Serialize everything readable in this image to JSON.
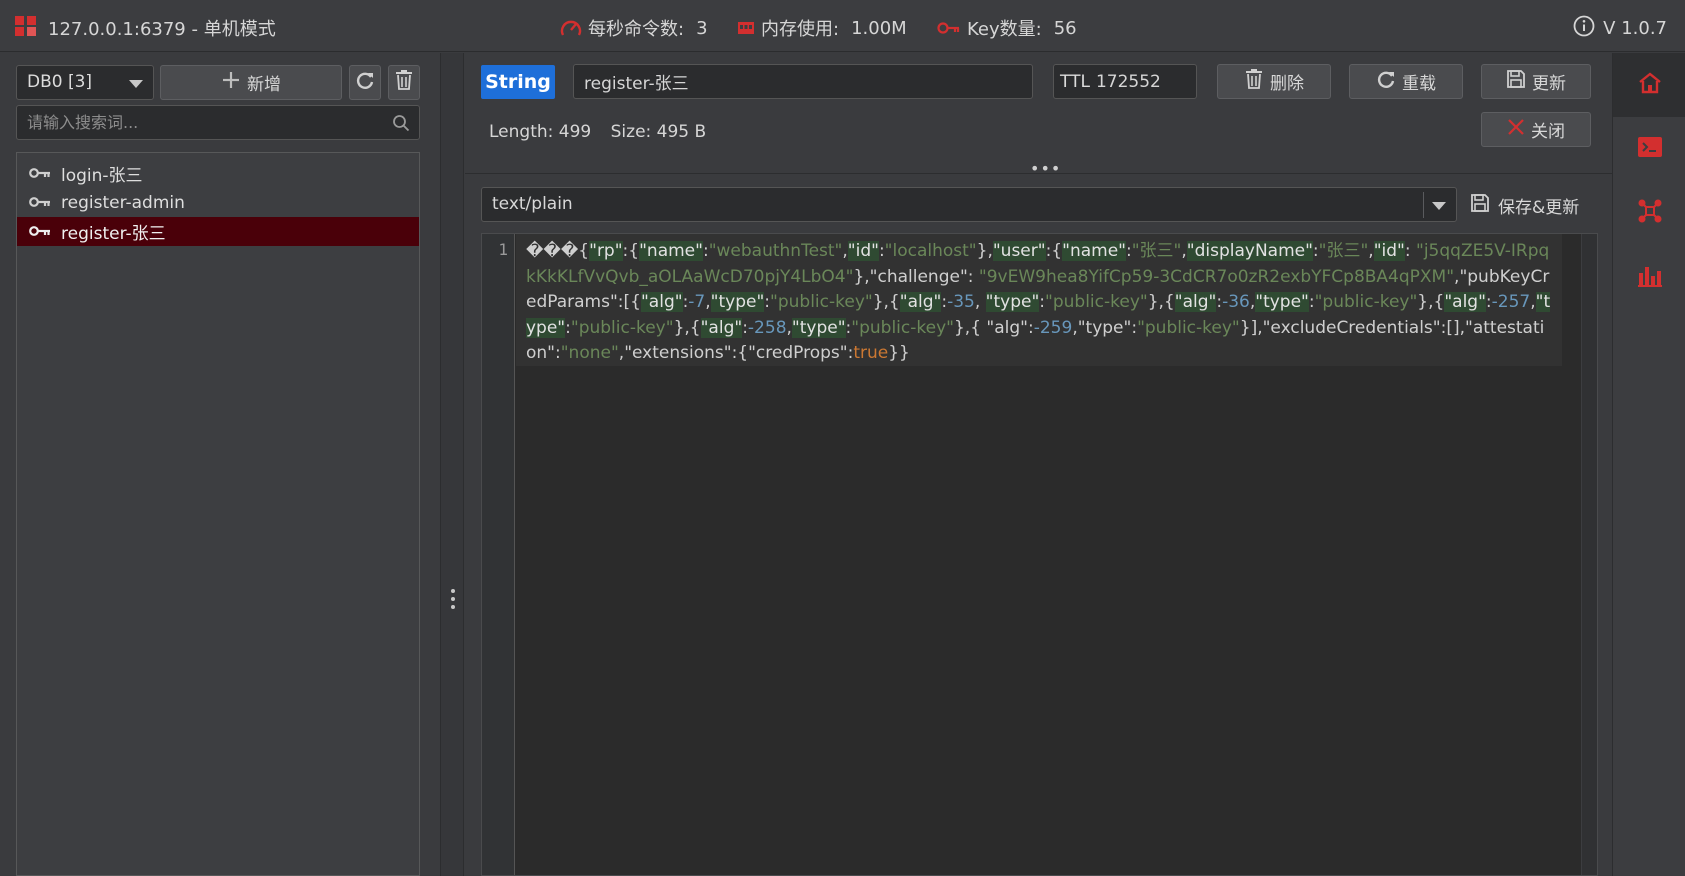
{
  "titlebar": {
    "connection": "127.0.0.1:6379 - 单机模式",
    "ops_label": "每秒命令数:",
    "ops_value": "3",
    "mem_label": "内存使用:",
    "mem_value": "1.00M",
    "keys_label": "Key数量:",
    "keys_value": "56",
    "version": "V 1.0.7"
  },
  "sidebar": {
    "db_selected": "DB0 [3]",
    "add_label": "新增",
    "search_placeholder": "请输入搜索词...",
    "keys": [
      {
        "name": "login-张三",
        "selected": false
      },
      {
        "name": "register-admin",
        "selected": false
      },
      {
        "name": "register-张三",
        "selected": true
      }
    ]
  },
  "detail": {
    "type": "String",
    "key_name": "register-张三",
    "ttl_label": "TTL",
    "ttl_value": "172552",
    "delete_label": "删除",
    "reload_label": "重载",
    "update_label": "更新",
    "close_label": "关闭",
    "length_text": "Length: 499",
    "size_text": "Size: 495 B",
    "format": "text/plain",
    "save_update_label": "保存&更新",
    "line_number": "1"
  },
  "colors": {
    "accent": "#d32f2f",
    "type_badge": "#1e6fd9",
    "selected_row": "#4a0009"
  },
  "icons": {
    "titlebar": [
      "app-logo-icon",
      "gauge-icon",
      "memory-icon",
      "key-icon",
      "info-icon"
    ],
    "right_bar": [
      "home-icon",
      "terminal-icon",
      "cluster-icon",
      "bar-chart-icon"
    ]
  }
}
